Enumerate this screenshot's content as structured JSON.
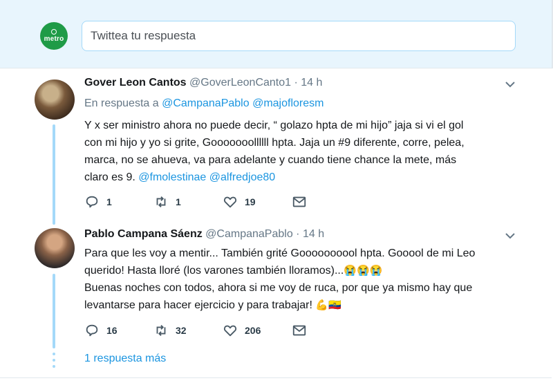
{
  "reply_box": {
    "placeholder": "Twittea tu respuesta",
    "avatar_label": "metro"
  },
  "tweets": [
    {
      "name": "Gover Leon Cantos",
      "handle": "@GoverLeonCanto1",
      "time": "· 14 h",
      "replying_to": {
        "prefix": "En respuesta a",
        "mentions": [
          "@CampanaPablo",
          "@majofloresm"
        ]
      },
      "text_lines": [
        "Y x ser ministro ahora no puede decir, “ golazo hpta de mi hijo” jaja si vi el gol",
        "con mi hijo y yo si grite, Gooooooollllll hpta. Jaja un #9 diferente, corre, pelea,",
        "marca, no se ahueva, va para adelante y cuando tiene chance la mete, más"
      ],
      "last_line_text": "claro es 9.",
      "last_line_mentions": [
        "@fmolestinae",
        "@alfredjoe80"
      ],
      "replies": "1",
      "retweets": "1",
      "likes": "19"
    },
    {
      "name": "Pablo Campana Sáenz",
      "handle": "@CampanaPablo",
      "time": "· 14 h",
      "text_lines": [
        "Para que les voy a mentir... También grité Goooooooool hpta. Gooool de mi Leo",
        "querido! Hasta lloré (los varones también lloramos)...",
        "Buenas noches con todos, ahora si me voy de ruca, por que ya mismo hay que",
        "levantarse para hacer ejercicio y para trabajar!"
      ],
      "crying_emojis": "😭😭😭",
      "end_emojis": "💪🇪🇨",
      "replies": "16",
      "retweets": "32",
      "likes": "206"
    }
  ],
  "more_replies": "1 respuesta más",
  "colors": {
    "accent": "#1b95e0",
    "thread": "#a4d9f9",
    "brand": "#1f9b47"
  },
  "icons": [
    "reply-icon",
    "retweet-icon",
    "like-icon",
    "dm-icon",
    "chevron-down-icon"
  ]
}
